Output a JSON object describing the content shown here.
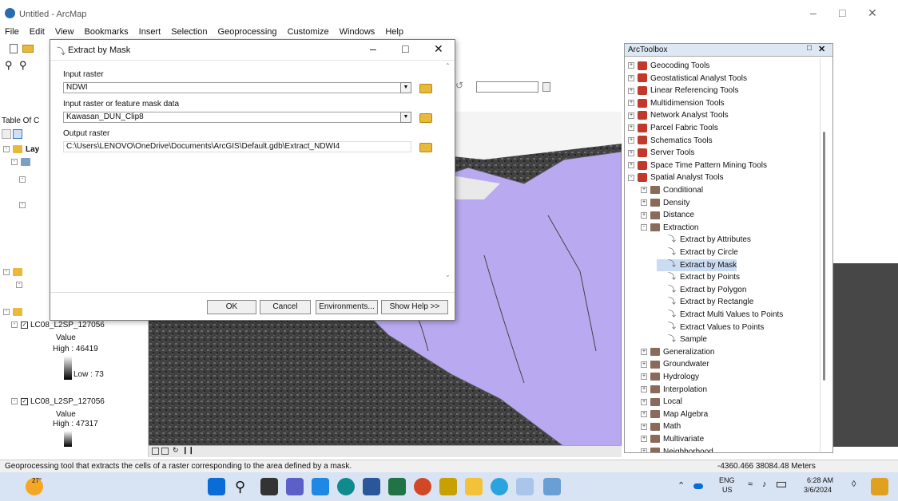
{
  "window": {
    "title": "Untitled - ArcMap"
  },
  "menu": [
    "File",
    "Edit",
    "View",
    "Bookmarks",
    "Insert",
    "Selection",
    "Geoprocessing",
    "Customize",
    "Windows",
    "Help"
  ],
  "toc": {
    "title": "Table Of C",
    "layer_label": "Lay",
    "items": [
      {
        "name": "LC08_L2SP_127056",
        "value_label": "Value",
        "high": "High : 46419",
        "low": "Low : 73"
      },
      {
        "name": "LC08_L2SP_127056",
        "value_label": "Value",
        "high": "High : 47317"
      }
    ]
  },
  "dialog": {
    "title": "Extract by Mask",
    "input_raster_label": "Input raster",
    "input_raster_value": "NDWI",
    "mask_label": "Input raster or feature mask data",
    "mask_value": "Kawasan_DUN_Clip8",
    "output_label": "Output raster",
    "output_value": "C:\\Users\\LENOVO\\OneDrive\\Documents\\ArcGIS\\Default.gdb\\Extract_NDWI4",
    "buttons": {
      "ok": "OK",
      "cancel": "Cancel",
      "environments": "Environments...",
      "help": "Show Help >>"
    }
  },
  "toolbox": {
    "title": "ArcToolbox",
    "items": [
      {
        "label": "Geocoding Tools",
        "level": 0,
        "type": "box",
        "exp": "+"
      },
      {
        "label": "Geostatistical Analyst Tools",
        "level": 0,
        "type": "box",
        "exp": "+"
      },
      {
        "label": "Linear Referencing Tools",
        "level": 0,
        "type": "box",
        "exp": "+"
      },
      {
        "label": "Multidimension Tools",
        "level": 0,
        "type": "box",
        "exp": "+"
      },
      {
        "label": "Network Analyst Tools",
        "level": 0,
        "type": "box",
        "exp": "+"
      },
      {
        "label": "Parcel Fabric Tools",
        "level": 0,
        "type": "box",
        "exp": "+"
      },
      {
        "label": "Schematics Tools",
        "level": 0,
        "type": "box",
        "exp": "+"
      },
      {
        "label": "Server Tools",
        "level": 0,
        "type": "box",
        "exp": "+"
      },
      {
        "label": "Space Time Pattern Mining Tools",
        "level": 0,
        "type": "box",
        "exp": "+"
      },
      {
        "label": "Spatial Analyst Tools",
        "level": 0,
        "type": "box",
        "exp": "-"
      },
      {
        "label": "Conditional",
        "level": 1,
        "type": "set",
        "exp": "+"
      },
      {
        "label": "Density",
        "level": 1,
        "type": "set",
        "exp": "+"
      },
      {
        "label": "Distance",
        "level": 1,
        "type": "set",
        "exp": "+"
      },
      {
        "label": "Extraction",
        "level": 1,
        "type": "set",
        "exp": "-"
      },
      {
        "label": "Extract by Attributes",
        "level": 2,
        "type": "tool",
        "exp": ""
      },
      {
        "label": "Extract by Circle",
        "level": 2,
        "type": "tool",
        "exp": ""
      },
      {
        "label": "Extract by Mask",
        "level": 2,
        "type": "tool",
        "exp": ""
      },
      {
        "label": "Extract by Points",
        "level": 2,
        "type": "tool",
        "exp": ""
      },
      {
        "label": "Extract by Polygon",
        "level": 2,
        "type": "tool",
        "exp": ""
      },
      {
        "label": "Extract by Rectangle",
        "level": 2,
        "type": "tool",
        "exp": ""
      },
      {
        "label": "Extract Multi Values to Points",
        "level": 2,
        "type": "tool",
        "exp": ""
      },
      {
        "label": "Extract Values to Points",
        "level": 2,
        "type": "tool",
        "exp": ""
      },
      {
        "label": "Sample",
        "level": 2,
        "type": "tool",
        "exp": ""
      },
      {
        "label": "Generalization",
        "level": 1,
        "type": "set",
        "exp": "+"
      },
      {
        "label": "Groundwater",
        "level": 1,
        "type": "set",
        "exp": "+"
      },
      {
        "label": "Hydrology",
        "level": 1,
        "type": "set",
        "exp": "+"
      },
      {
        "label": "Interpolation",
        "level": 1,
        "type": "set",
        "exp": "+"
      },
      {
        "label": "Local",
        "level": 1,
        "type": "set",
        "exp": "+"
      },
      {
        "label": "Map Algebra",
        "level": 1,
        "type": "set",
        "exp": "+"
      },
      {
        "label": "Math",
        "level": 1,
        "type": "set",
        "exp": "+"
      },
      {
        "label": "Multivariate",
        "level": 1,
        "type": "set",
        "exp": "+"
      },
      {
        "label": "Neighborhood",
        "level": 1,
        "type": "set",
        "exp": "+"
      }
    ]
  },
  "status": {
    "message": "Geoprocessing tool that extracts the cells of a raster corresponding to the area defined by a mask.",
    "coords": "-4360.466  38084.48 Meters"
  },
  "taskbar": {
    "weather": "27°",
    "lang1": "ENG",
    "lang2": "US",
    "time": "6:28 AM",
    "date": "3/6/2024"
  },
  "colors": {
    "dialog_selected": "#c9dcf3",
    "map_polygon": "#b9a9f0",
    "taskbar": "#d8e4f4"
  }
}
